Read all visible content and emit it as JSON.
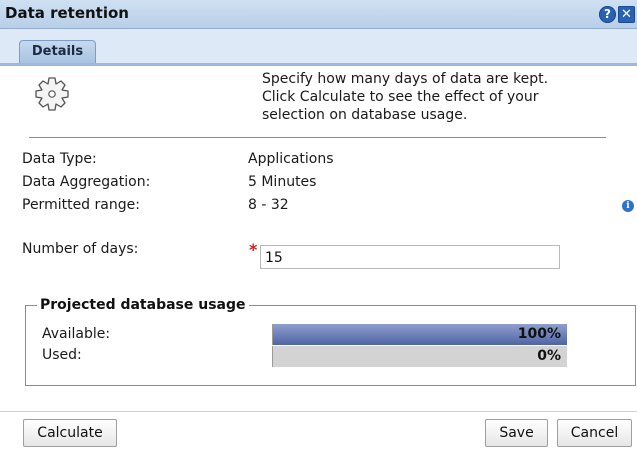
{
  "window": {
    "title": "Data retention",
    "help_glyph": "?",
    "close_glyph": "✕"
  },
  "tabs": [
    {
      "label": "Details",
      "active": true
    }
  ],
  "intro": {
    "icon": "gear-icon",
    "lines": [
      "Specify how many days of data are kept.",
      "Click Calculate to see the effect of your",
      "selection on database usage."
    ]
  },
  "details": {
    "data_type_label": "Data Type:",
    "data_type_value": "Applications",
    "aggregation_label": "Data Aggregation:",
    "aggregation_value": "5 Minutes",
    "range_label": "Permitted range:",
    "range_value": "8 - 32",
    "info_glyph": "i"
  },
  "days": {
    "label": "Number of days:",
    "required_mark": "*",
    "value": "15"
  },
  "usage": {
    "legend": "Projected database usage",
    "available_label": "Available:",
    "available_text": "100%",
    "available_fraction": 1.0,
    "used_label": "Used:",
    "used_text": "0%",
    "used_fraction": 0.0
  },
  "buttons": {
    "calculate": "Calculate",
    "save": "Save",
    "cancel": "Cancel"
  },
  "colors": {
    "accent": "#2a62b3",
    "bar_fill": "#4f64a6",
    "required": "#d61b1b"
  }
}
